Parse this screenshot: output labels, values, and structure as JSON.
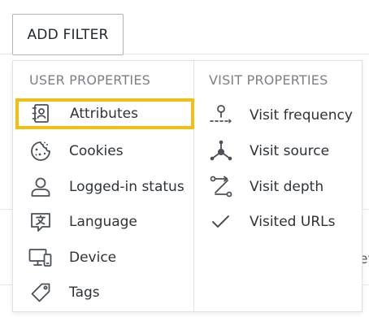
{
  "toolbar": {
    "add_filter_label": "ADD FILTER"
  },
  "background": {
    "row_text_fragment": "ey"
  },
  "dropdown": {
    "user_properties": {
      "header": "USER PROPERTIES",
      "items": [
        {
          "label": "Attributes",
          "icon": "contact-book-icon",
          "selected": true
        },
        {
          "label": "Cookies",
          "icon": "cookie-icon"
        },
        {
          "label": "Logged-in status",
          "icon": "user-icon"
        },
        {
          "label": "Language",
          "icon": "translate-icon"
        },
        {
          "label": "Device",
          "icon": "devices-icon"
        },
        {
          "label": "Tags",
          "icon": "tag-icon"
        }
      ]
    },
    "visit_properties": {
      "header": "VISIT PROPERTIES",
      "items": [
        {
          "label": "Visit frequency",
          "icon": "frequency-icon"
        },
        {
          "label": "Visit source",
          "icon": "source-network-icon"
        },
        {
          "label": "Visit depth",
          "icon": "depth-path-icon"
        },
        {
          "label": "Visited URLs",
          "icon": "checkmark-icon"
        }
      ]
    },
    "highlight_color": "#f2be11"
  }
}
